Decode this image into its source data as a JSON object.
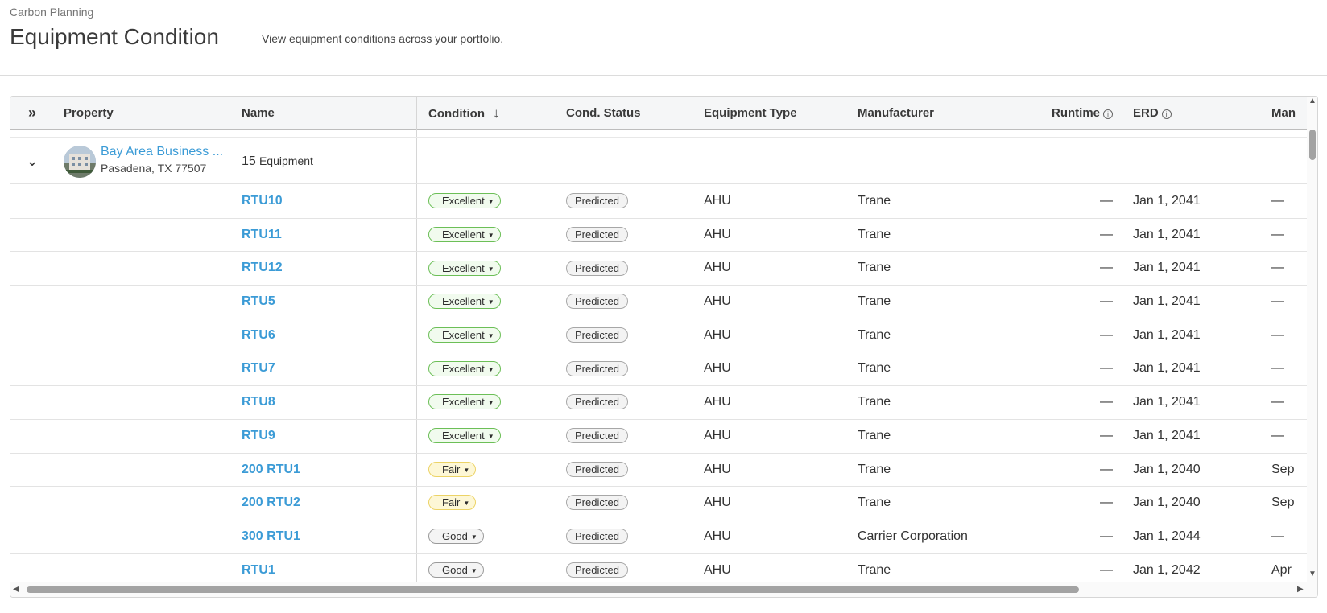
{
  "header": {
    "breadcrumb": "Carbon Planning",
    "title": "Equipment Condition",
    "subtitle": "View equipment conditions across your portfolio."
  },
  "columns": {
    "expand_icon": "double-chevron-right-icon",
    "property": "Property",
    "name": "Name",
    "condition": "Condition",
    "cond_status": "Cond. Status",
    "equipment_type": "Equipment Type",
    "manufacturer": "Manufacturer",
    "runtime": "Runtime",
    "erd": "ERD",
    "man": "Man"
  },
  "group": {
    "property_name": "Bay Area Business ...",
    "address": "Pasadena, TX 77507",
    "count": "15",
    "count_label": "Equipment"
  },
  "rows": [
    {
      "name": "RTU10",
      "condition": "Excellent",
      "status": "Predicted",
      "type": "AHU",
      "manufacturer": "Trane",
      "runtime": "—",
      "erd": "Jan 1, 2041",
      "man": "—"
    },
    {
      "name": "RTU11",
      "condition": "Excellent",
      "status": "Predicted",
      "type": "AHU",
      "manufacturer": "Trane",
      "runtime": "—",
      "erd": "Jan 1, 2041",
      "man": "—"
    },
    {
      "name": "RTU12",
      "condition": "Excellent",
      "status": "Predicted",
      "type": "AHU",
      "manufacturer": "Trane",
      "runtime": "—",
      "erd": "Jan 1, 2041",
      "man": "—"
    },
    {
      "name": "RTU5",
      "condition": "Excellent",
      "status": "Predicted",
      "type": "AHU",
      "manufacturer": "Trane",
      "runtime": "—",
      "erd": "Jan 1, 2041",
      "man": "—"
    },
    {
      "name": "RTU6",
      "condition": "Excellent",
      "status": "Predicted",
      "type": "AHU",
      "manufacturer": "Trane",
      "runtime": "—",
      "erd": "Jan 1, 2041",
      "man": "—"
    },
    {
      "name": "RTU7",
      "condition": "Excellent",
      "status": "Predicted",
      "type": "AHU",
      "manufacturer": "Trane",
      "runtime": "—",
      "erd": "Jan 1, 2041",
      "man": "—"
    },
    {
      "name": "RTU8",
      "condition": "Excellent",
      "status": "Predicted",
      "type": "AHU",
      "manufacturer": "Trane",
      "runtime": "—",
      "erd": "Jan 1, 2041",
      "man": "—"
    },
    {
      "name": "RTU9",
      "condition": "Excellent",
      "status": "Predicted",
      "type": "AHU",
      "manufacturer": "Trane",
      "runtime": "—",
      "erd": "Jan 1, 2041",
      "man": "—"
    },
    {
      "name": "200 RTU1",
      "condition": "Fair",
      "status": "Predicted",
      "type": "AHU",
      "manufacturer": "Trane",
      "runtime": "—",
      "erd": "Jan 1, 2040",
      "man": "Sep"
    },
    {
      "name": "200 RTU2",
      "condition": "Fair",
      "status": "Predicted",
      "type": "AHU",
      "manufacturer": "Trane",
      "runtime": "—",
      "erd": "Jan 1, 2040",
      "man": "Sep"
    },
    {
      "name": "300 RTU1",
      "condition": "Good",
      "status": "Predicted",
      "type": "AHU",
      "manufacturer": "Carrier Corporation",
      "runtime": "—",
      "erd": "Jan 1, 2044",
      "man": "—"
    },
    {
      "name": "RTU1",
      "condition": "Good",
      "status": "Predicted",
      "type": "AHU",
      "manufacturer": "Trane",
      "runtime": "—",
      "erd": "Jan 1, 2042",
      "man": "Apr"
    }
  ],
  "colors": {
    "link": "#3b9bd6",
    "excellent_border": "#6cbf57",
    "fair_border": "#ecd366",
    "good_border": "#9a9a9a"
  }
}
